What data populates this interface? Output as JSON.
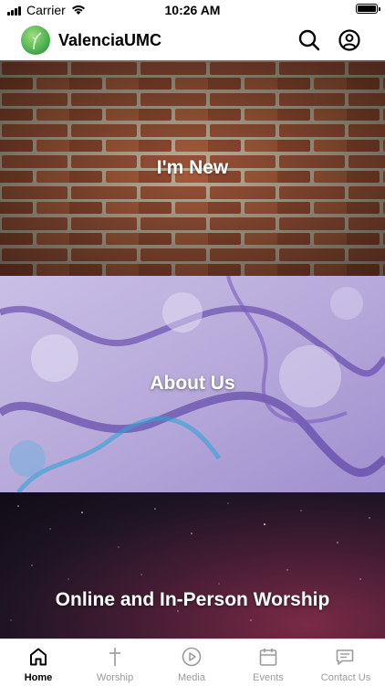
{
  "status_bar": {
    "carrier": "Carrier",
    "time": "10:26 AM"
  },
  "header": {
    "app_name": "ValenciaUMC"
  },
  "tiles": [
    {
      "label": "I'm New"
    },
    {
      "label": "About Us"
    },
    {
      "label": "Online and In-Person Worship"
    }
  ],
  "tabs": [
    {
      "label": "Home",
      "icon": "home-icon",
      "active": true
    },
    {
      "label": "Worship",
      "icon": "cross-icon",
      "active": false
    },
    {
      "label": "Media",
      "icon": "play-icon",
      "active": false
    },
    {
      "label": "Events",
      "icon": "calendar-icon",
      "active": false
    },
    {
      "label": "Contact Us",
      "icon": "message-icon",
      "active": false
    }
  ],
  "colors": {
    "active_tab": "#000000",
    "inactive_tab": "#9a9a9a",
    "logo_green": "#4caf50"
  }
}
